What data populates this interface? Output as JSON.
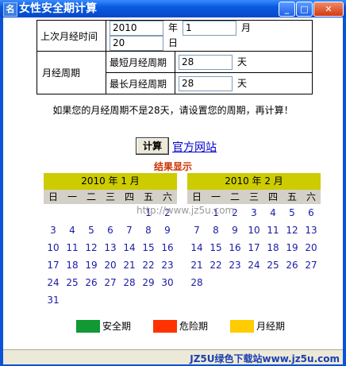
{
  "window": {
    "title": "女性安全期计算",
    "icon_char": "名"
  },
  "form": {
    "last_period_label": "上次月经时间",
    "year": "2010",
    "year_unit": "年",
    "month": "1",
    "month_unit": "月",
    "day": "20",
    "day_unit": "日",
    "cycle_label": "月经周期",
    "shortest_label": "最短月经周期",
    "shortest_value": "28",
    "longest_label": "最长月经周期",
    "longest_value": "28",
    "cycle_unit": "天"
  },
  "notice": "如果您的月经周期不是28天，请设置您的周期，再计算！",
  "calc_button": "计算",
  "official_site_link": "官方网站",
  "result_title": "结果显示",
  "calendar_url": "http://www.jz5u.com",
  "weekdays": [
    "日",
    "一",
    "二",
    "三",
    "四",
    "五",
    "六"
  ],
  "calendars": [
    {
      "title": "2010 年  1 月",
      "days": [
        "",
        "",
        "",
        "",
        "",
        "1",
        "2",
        "3",
        "4",
        "5",
        "6",
        "7",
        "8",
        "9",
        "10",
        "11",
        "12",
        "13",
        "14",
        "15",
        "16",
        "17",
        "18",
        "19",
        "20",
        "21",
        "22",
        "23",
        "24",
        "25",
        "26",
        "27",
        "28",
        "29",
        "30",
        "31"
      ]
    },
    {
      "title": "2010 年  2 月",
      "days": [
        "",
        "1",
        "2",
        "3",
        "4",
        "5",
        "6",
        "7",
        "8",
        "9",
        "10",
        "11",
        "12",
        "13",
        "14",
        "15",
        "16",
        "17",
        "18",
        "19",
        "20",
        "21",
        "22",
        "23",
        "24",
        "25",
        "26",
        "27",
        "28"
      ]
    }
  ],
  "legend": [
    {
      "label": "安全期",
      "color": "#119933"
    },
    {
      "label": "危险期",
      "color": "#ff3300"
    },
    {
      "label": "月经期",
      "color": "#ffcc00"
    }
  ],
  "watermark": "JZ5U绿色下载站www.jz5u.com"
}
